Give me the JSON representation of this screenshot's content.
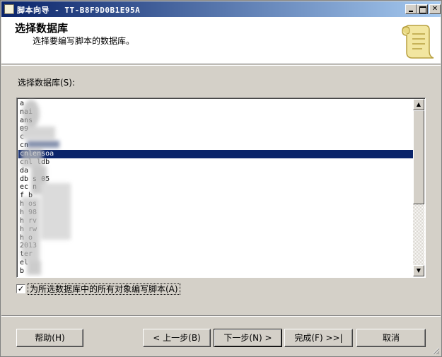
{
  "window": {
    "title": "脚本向导 - TT-B8F9D0B1E95A",
    "minimize_label": "",
    "maximize_label": "",
    "close_label": "✕"
  },
  "header": {
    "title": "选择数据库",
    "subtitle": "选择要编写脚本的数据库。",
    "icon": "scroll-icon"
  },
  "database_list": {
    "label": "选择数据库(S):",
    "items": [
      "a",
      "     nai",
      "     ans",
      "     09",
      "c",
      "cn",
      "cnlensoa",
      "cnl  ldb",
      "da",
      "db  s     05",
      "ec    n",
      "f     b",
      "h     os",
      "h   98",
      "h    rv",
      "h    rw",
      "h    o",
      "   2013",
      "    ter",
      "    el",
      "    b"
    ],
    "selected_index": 6
  },
  "options": {
    "script_all_objects_checked": true,
    "script_all_objects_label": "为所选数据库中的所有对象编写脚本(A)"
  },
  "buttons": {
    "help": "帮助(H)",
    "back": "< 上一步(B)",
    "next": "下一步(N) >",
    "finish": "完成(F) >>|",
    "cancel": "取消"
  },
  "colors": {
    "titlebar_start": "#0a246a",
    "titlebar_end": "#a6caf0",
    "selection": "#0a246a",
    "dialog_bg": "#d4d0c8"
  }
}
